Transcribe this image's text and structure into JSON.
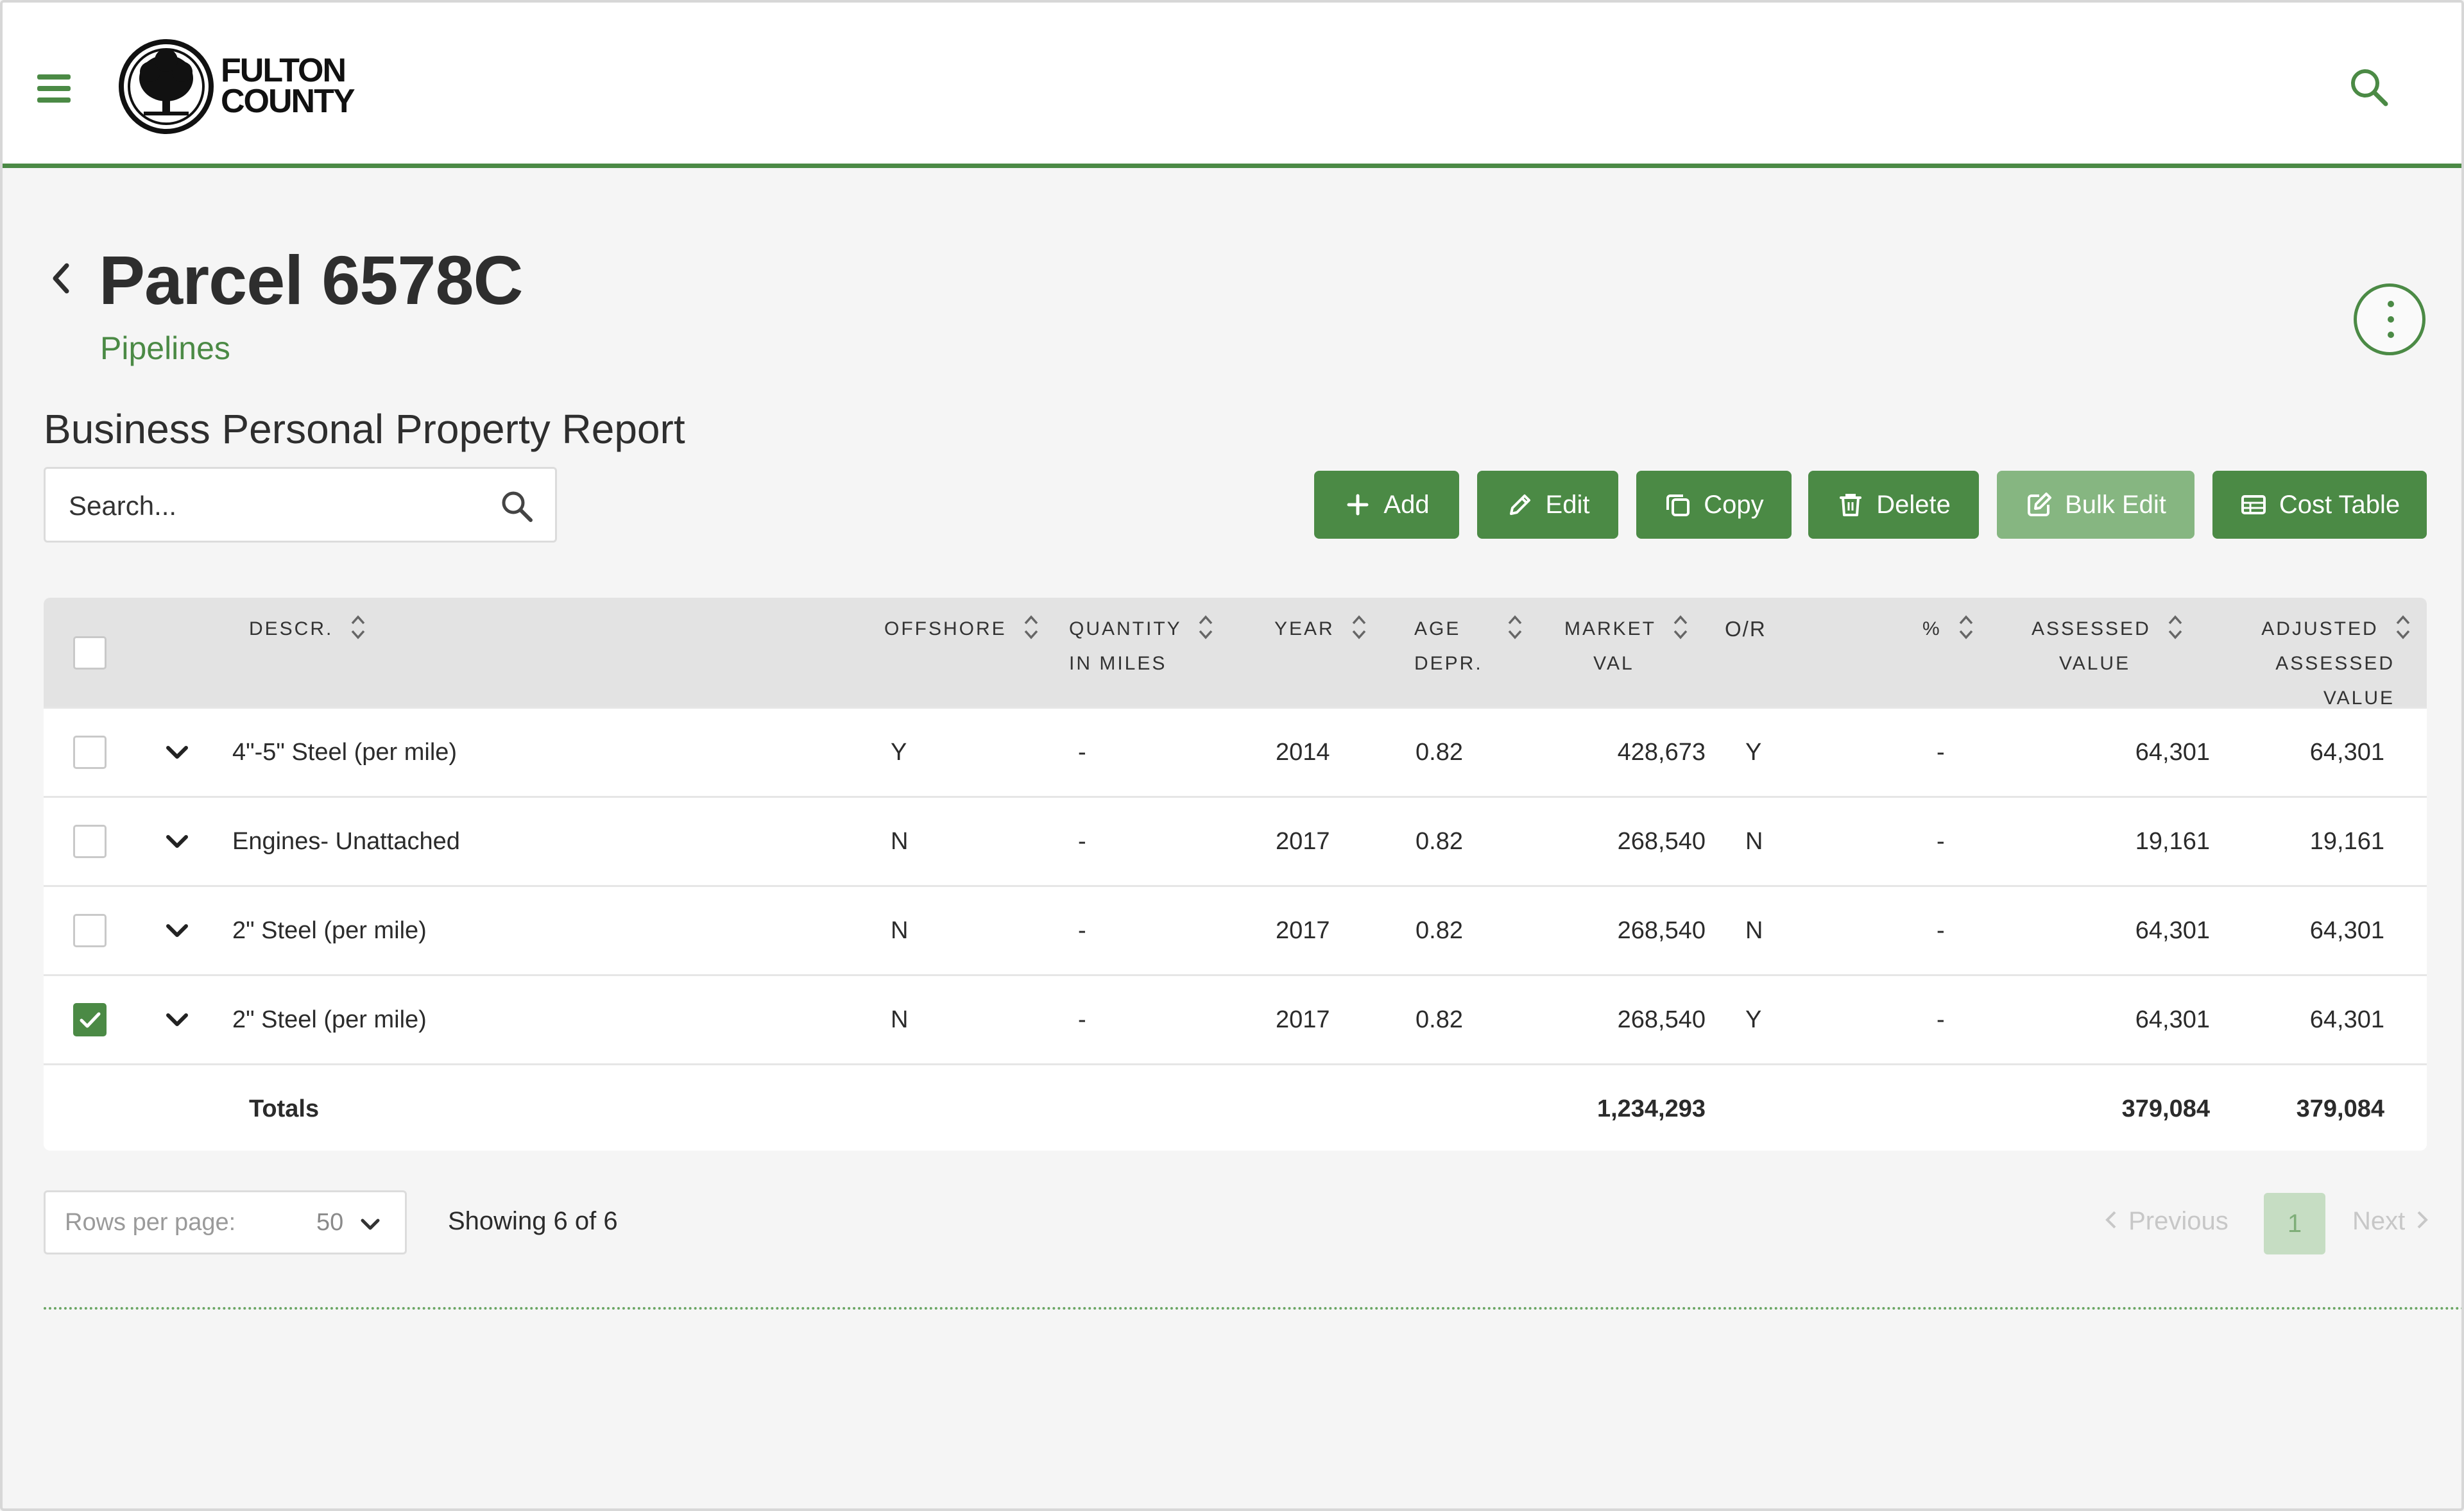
{
  "header": {
    "logo_line1": "FULTON",
    "logo_line2": "COUNTY",
    "menu_icon": "hamburger-icon",
    "search_icon": "search-icon"
  },
  "page": {
    "title": "Parcel 6578C",
    "subtitle": "Pipelines",
    "report_title": "Business Personal Property Report"
  },
  "search": {
    "placeholder": "Search..."
  },
  "toolbar": {
    "add": "Add",
    "edit": "Edit",
    "copy": "Copy",
    "delete": "Delete",
    "bulk_edit": "Bulk Edit",
    "cost_table": "Cost Table"
  },
  "table": {
    "headers": {
      "descr": "DESCR.",
      "offshore": "OFFSHORE",
      "quantity_1": "QUANTITY",
      "quantity_2": "IN MILES",
      "year": "YEAR",
      "age_1": "AGE",
      "age_2": "DEPR.",
      "market_1": "MARKET",
      "market_2": "VAL",
      "or": "O/R",
      "pct": "%",
      "assessed_1": "ASSESSED",
      "assessed_2": "VALUE",
      "adjusted_1": "ADJUSTED",
      "adjusted_2": "ASSESSED VALUE"
    },
    "rows": [
      {
        "checked": false,
        "descr": "4\"-5\" Steel (per mile)",
        "offshore": "Y",
        "quantity": "-",
        "year": "2014",
        "age": "0.82",
        "market": "428,673",
        "or": "Y",
        "pct": "-",
        "assessed": "64,301",
        "adjusted": "64,301"
      },
      {
        "checked": false,
        "descr": "Engines- Unattached",
        "offshore": "N",
        "quantity": "-",
        "year": "2017",
        "age": "0.82",
        "market": "268,540",
        "or": "N",
        "pct": "-",
        "assessed": "19,161",
        "adjusted": "19,161"
      },
      {
        "checked": false,
        "descr": "2\" Steel (per mile)",
        "offshore": "N",
        "quantity": "-",
        "year": "2017",
        "age": "0.82",
        "market": "268,540",
        "or": "N",
        "pct": "-",
        "assessed": "64,301",
        "adjusted": "64,301"
      },
      {
        "checked": true,
        "descr": "2\" Steel (per mile)",
        "offshore": "N",
        "quantity": "-",
        "year": "2017",
        "age": "0.82",
        "market": "268,540",
        "or": "Y",
        "pct": "-",
        "assessed": "64,301",
        "adjusted": "64,301"
      }
    ],
    "totals": {
      "label": "Totals",
      "market": "1,234,293",
      "assessed": "379,084",
      "adjusted": "379,084"
    }
  },
  "pagination": {
    "rows_per_page_label": "Rows per page:",
    "rows_per_page_value": "50",
    "showing": "Showing 6 of 6",
    "previous": "Previous",
    "current_page": "1",
    "next": "Next"
  },
  "colors": {
    "brand_green": "#4b8a45",
    "disabled_green": "#86b681",
    "header_gray": "#e3e3e3"
  }
}
